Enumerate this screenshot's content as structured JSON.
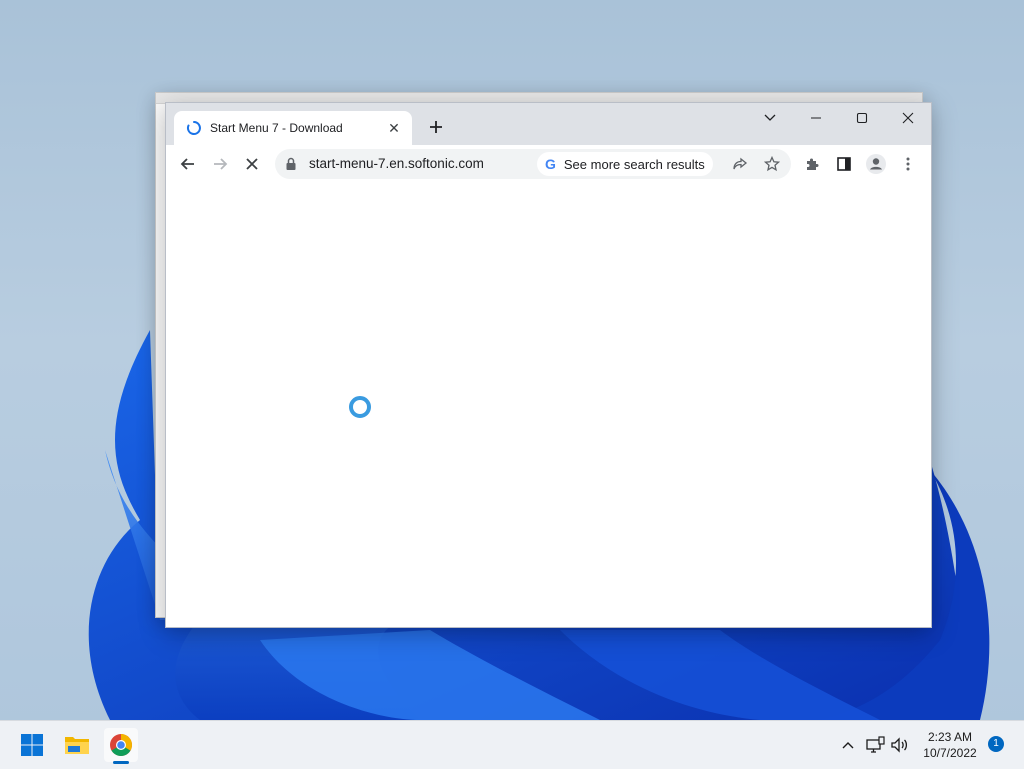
{
  "browser": {
    "tab": {
      "title": "Start Menu 7 - Download"
    },
    "omnibox": {
      "url": "start-menu-7.en.softonic.com",
      "suggestion": "See more search results"
    }
  },
  "taskbar": {
    "time": "2:23 AM",
    "date": "10/7/2022",
    "notification_count": "1"
  },
  "colors": {
    "accent": "#0067c0",
    "chrome_tabstrip": "#dee1e6",
    "loader": "#3a9be0"
  }
}
